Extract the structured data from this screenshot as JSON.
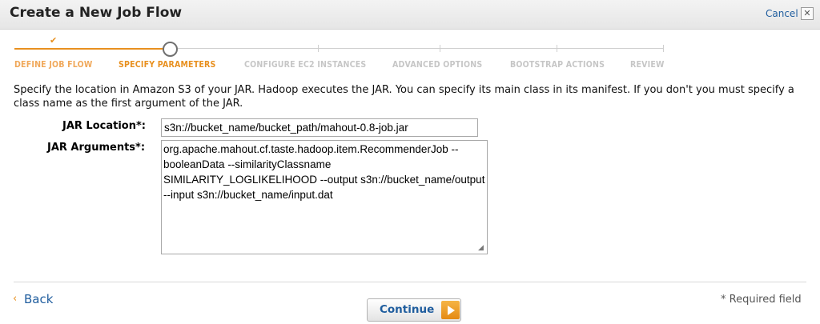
{
  "header": {
    "title": "Create a New Job Flow",
    "cancel_label": "Cancel",
    "close_glyph": "✕"
  },
  "steps": [
    {
      "label": "DEFINE JOB FLOW",
      "state": "done"
    },
    {
      "label": "SPECIFY PARAMETERS",
      "state": "current"
    },
    {
      "label": "CONFIGURE EC2 INSTANCES",
      "state": "todo"
    },
    {
      "label": "ADVANCED OPTIONS",
      "state": "todo"
    },
    {
      "label": "BOOTSTRAP ACTIONS",
      "state": "todo"
    },
    {
      "label": "REVIEW",
      "state": "todo"
    }
  ],
  "step_check_glyph": "✔",
  "description": "Specify the location in Amazon S3 of your JAR. Hadoop executes the JAR. You can specify its main class in its manifest. If you don't you must specify a class name as the first argument of the JAR.",
  "form": {
    "jar_location_label": "JAR Location*:",
    "jar_location_value": "s3n://bucket_name/bucket_path/mahout-0.8-job.jar",
    "jar_arguments_label": "JAR Arguments*:",
    "jar_arguments_value": "org.apache.mahout.cf.taste.hadoop.item.RecommenderJob --booleanData --similarityClassname SIMILARITY_LOGLIKELIHOOD --output s3n://bucket_name/output --input s3n://bucket_name/input.dat"
  },
  "footer": {
    "back_glyph": "‹",
    "back_label": "Back",
    "continue_label": "Continue",
    "required_note": "* Required field"
  },
  "colors": {
    "accent_orange": "#e8901f",
    "link_blue": "#1f5d9e"
  }
}
